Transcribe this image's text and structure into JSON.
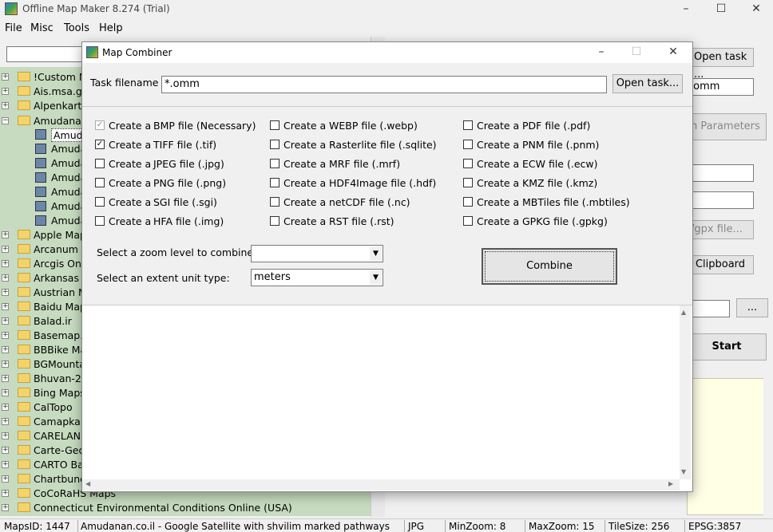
{
  "app": {
    "title": "Offline Map Maker 8.274 (Trial)",
    "window_controls": {
      "minimize": "–",
      "maximize": "☐",
      "close": "✕"
    },
    "menu": [
      "File",
      "Misc",
      "Tools",
      "Help"
    ]
  },
  "tree": {
    "rows": [
      {
        "label": "!Custom M",
        "type": "folder",
        "expander": "+"
      },
      {
        "label": "Ais.msa.go",
        "type": "folder",
        "expander": "+"
      },
      {
        "label": "Alpenkarte",
        "type": "folder",
        "expander": "+"
      },
      {
        "label": "Amudanan",
        "type": "folder-open",
        "expander": "−"
      },
      {
        "label": "Amuda",
        "type": "map",
        "selected": true
      },
      {
        "label": "Amuda",
        "type": "map"
      },
      {
        "label": "Amuda",
        "type": "map"
      },
      {
        "label": "Amuda",
        "type": "map"
      },
      {
        "label": "Amuda",
        "type": "map"
      },
      {
        "label": "Amuda",
        "type": "map"
      },
      {
        "label": "Amuda",
        "type": "map"
      },
      {
        "label": "Apple Map",
        "type": "folder",
        "expander": "+"
      },
      {
        "label": "Arcanum M",
        "type": "folder",
        "expander": "+"
      },
      {
        "label": "Arcgis Onli",
        "type": "folder",
        "expander": "+"
      },
      {
        "label": "Arkansas C",
        "type": "folder",
        "expander": "+"
      },
      {
        "label": "Austrian M",
        "type": "folder",
        "expander": "+"
      },
      {
        "label": "Baidu Map",
        "type": "folder",
        "expander": "+"
      },
      {
        "label": "Balad.ir",
        "type": "folder",
        "expander": "+"
      },
      {
        "label": "Basemap.a",
        "type": "folder",
        "expander": "+"
      },
      {
        "label": "BBBike Map",
        "type": "folder",
        "expander": "+"
      },
      {
        "label": "BGMountai",
        "type": "folder",
        "expander": "+"
      },
      {
        "label": "Bhuvan-2D",
        "type": "folder",
        "expander": "+"
      },
      {
        "label": "Bing Maps",
        "type": "folder",
        "expander": "+"
      },
      {
        "label": "CalTopo",
        "type": "folder",
        "expander": "+"
      },
      {
        "label": "Camapka.r",
        "type": "folder",
        "expander": "+"
      },
      {
        "label": "CARELAND",
        "type": "folder",
        "expander": "+"
      },
      {
        "label": "Carte-Geop",
        "type": "folder",
        "expander": "+"
      },
      {
        "label": "CARTO Bas",
        "type": "folder",
        "expander": "+"
      },
      {
        "label": "Chartbundl",
        "type": "folder",
        "expander": "+"
      },
      {
        "label": "CoCoRaHS Maps",
        "type": "folder",
        "expander": "+"
      },
      {
        "label": "Connecticut Environmental Conditions Online (USA)",
        "type": "folder",
        "expander": "+"
      }
    ]
  },
  "right_panel": {
    "open_task_label": "Open task ...",
    "filename_value": ".omm",
    "params_label": "n Parameters",
    "gpx_label": "/gpx file...",
    "clipboard_label": "Clipboard",
    "ellipsis_label": "...",
    "start_label": "Start"
  },
  "dialog": {
    "title": "Map Combiner",
    "task_filename_label": "Task filename",
    "task_filename_value": "*.omm",
    "open_task_label": "Open task...",
    "checkboxes": [
      {
        "prefix": "Create a",
        "label": "BMP file (Necessary)",
        "checked": true,
        "disabled": true
      },
      {
        "prefix": "Create a",
        "label": "TIFF file  (.tif)",
        "checked": true
      },
      {
        "prefix": "Create a",
        "label": "JPEG file  (.jpg)",
        "checked": false
      },
      {
        "prefix": "Create a",
        "label": "PNG file  (.png)",
        "checked": false
      },
      {
        "prefix": "Create a",
        "label": "SGI file  (.sgi)",
        "checked": false
      },
      {
        "prefix": "Create a",
        "label": "HFA file  (.img)",
        "checked": false
      },
      {
        "prefix": "Create a",
        "label": "WEBP file  (.webp)",
        "checked": false
      },
      {
        "prefix": "Create a",
        "label": "Rasterlite file  (.sqlite)",
        "checked": false
      },
      {
        "prefix": "Create a",
        "label": "MRF file  (.mrf)",
        "checked": false
      },
      {
        "prefix": "Create a",
        "label": "HDF4Image file  (.hdf)",
        "checked": false
      },
      {
        "prefix": "Create a",
        "label": "netCDF file  (.nc)",
        "checked": false
      },
      {
        "prefix": "Create a",
        "label": "RST file  (.rst)",
        "checked": false
      },
      {
        "prefix": "Create a",
        "label": "PDF file  (.pdf)",
        "checked": false
      },
      {
        "prefix": "Create a",
        "label": "PNM file  (.pnm)",
        "checked": false
      },
      {
        "prefix": "Create a",
        "label": "ECW file  (.ecw)",
        "checked": false
      },
      {
        "prefix": "Create a",
        "label": "KMZ file  (.kmz)",
        "checked": false
      },
      {
        "prefix": "Create a",
        "label": "MBTiles file  (.mbtiles)",
        "checked": false
      },
      {
        "prefix": "Create a",
        "label": "GPKG file  (.gpkg)",
        "checked": false
      }
    ],
    "zoom_label": "Select a zoom level to combine:",
    "zoom_value": "",
    "extent_label": "Select an extent unit type:",
    "extent_value": "meters",
    "combine_label": "Combine"
  },
  "statusbar": {
    "maps_id": "MapsID: 1447",
    "map_name": "Amudanan.co.il - Google Satellite with shvilim marked pathways",
    "format": "JPG",
    "min_zoom": "MinZoom: 8",
    "max_zoom": "MaxZoom: 15",
    "tile_size": "TileSize: 256",
    "epsg": "EPSG:3857"
  }
}
